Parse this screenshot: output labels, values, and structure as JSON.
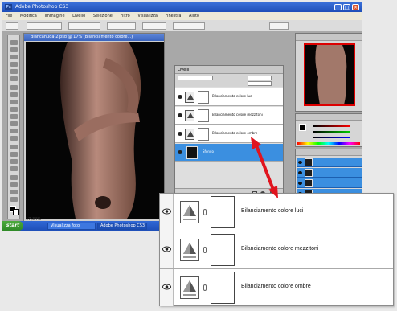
{
  "window": {
    "title": "Adobe Photoshop CS3"
  },
  "menubar": {
    "items": [
      "File",
      "Modifica",
      "Immagine",
      "Livello",
      "Selezione",
      "Filtro",
      "Visualizza",
      "Finestra",
      "Aiuto"
    ]
  },
  "document": {
    "title": "Biancanuda-2.psd @ 17% (Bilanciamento colore...)",
    "zoom": "17,34%"
  },
  "taskbar": {
    "start": "start",
    "tasks": [
      "Visualizza foto",
      "Adobe Photoshop CS3"
    ]
  },
  "layers_small": {
    "tab": "Livelli",
    "rows": [
      "Bilanciamento colore luci",
      "Bilanciamento colore mezzitoni",
      "Bilanciamento colore ombre",
      "Sfondo"
    ]
  },
  "zoom_panel": {
    "rows": [
      {
        "name": "Bilanciamento colore luci"
      },
      {
        "name": "Bilanciamento colore mezzitoni"
      },
      {
        "name": "Bilanciamento colore ombre"
      }
    ]
  },
  "colors": {
    "accent_arrow": "#e0141e",
    "selected_layer": "#3b8fe0"
  }
}
